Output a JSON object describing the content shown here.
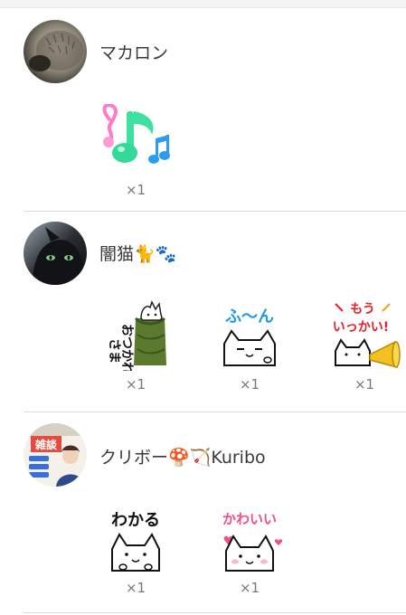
{
  "users": [
    {
      "name": "マカロン",
      "avatar": "hedgehog-avatar",
      "gifts": [
        {
          "icon": "music-notes-sticker-icon",
          "count": "×1"
        }
      ]
    },
    {
      "name": "闇猫🐈🐾",
      "avatar": "black-cat-avatar",
      "gifts": [
        {
          "icon": "otsukare-cat-sticker-icon",
          "text": "おつかれさま",
          "count": "×1"
        },
        {
          "icon": "fun-cat-sticker-icon",
          "text": "ふ〜ん",
          "count": "×1"
        },
        {
          "icon": "mou-ikkai-cat-sticker-icon",
          "text": "もう いっかい!",
          "count": "×1"
        }
      ]
    },
    {
      "name": "クリボー🍄🏹Kuribo",
      "avatar": "zatsudan-avatar",
      "avatar_text": "雑談",
      "gifts": [
        {
          "icon": "wakaru-cat-sticker-icon",
          "text": "わかる",
          "count": "×1"
        },
        {
          "icon": "kawaii-cat-sticker-icon",
          "text": "かわいい",
          "count": "×1"
        }
      ]
    }
  ]
}
